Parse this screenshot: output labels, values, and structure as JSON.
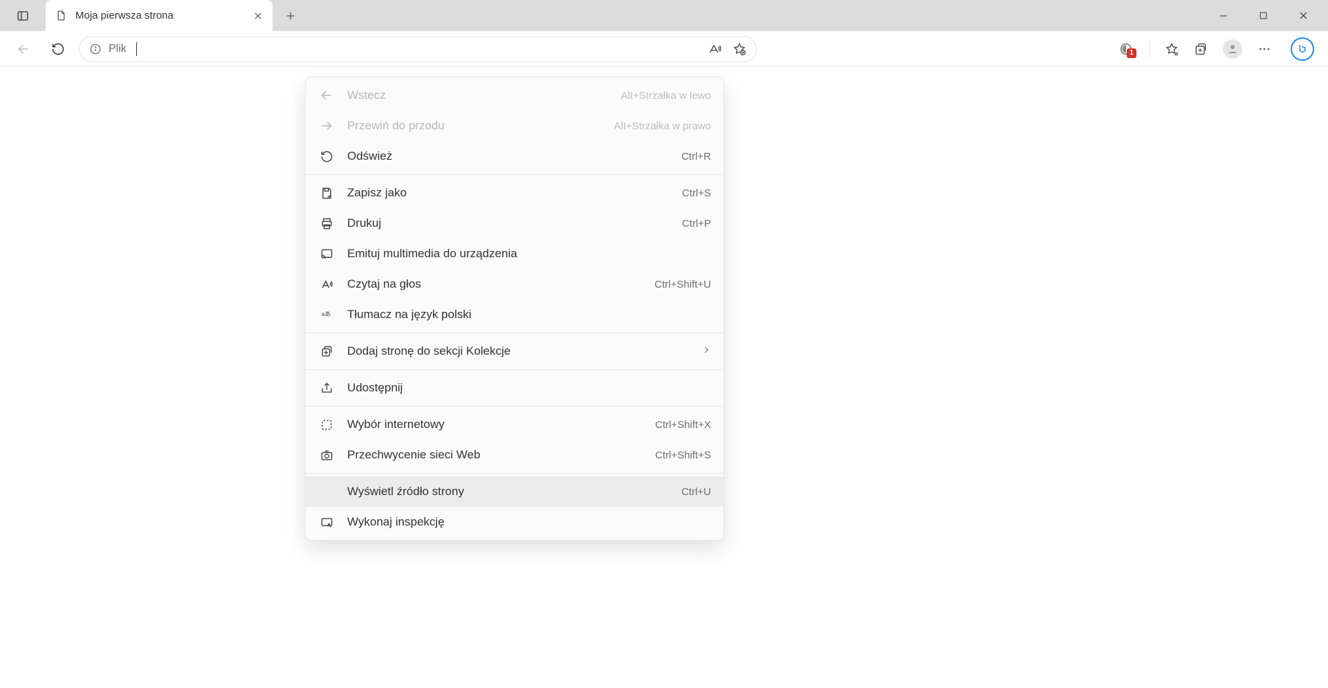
{
  "tab": {
    "title": "Moja pierwsza strona"
  },
  "addr": {
    "text": "Plik"
  },
  "badge": {
    "count": "1"
  },
  "ctx": {
    "back": {
      "label": "Wstecz",
      "accel": "Alt+Strzałka w lewo"
    },
    "forward": {
      "label": "Przewiń do przodu",
      "accel": "Alt+Strzałka w prawo"
    },
    "refresh": {
      "label": "Odśwież",
      "accel": "Ctrl+R"
    },
    "saveas": {
      "label": "Zapisz jako",
      "accel": "Ctrl+S"
    },
    "print": {
      "label": "Drukuj",
      "accel": "Ctrl+P"
    },
    "cast": {
      "label": "Emituj multimedia do urządzenia"
    },
    "readaloud": {
      "label": "Czytaj na głos",
      "accel": "Ctrl+Shift+U"
    },
    "translate": {
      "label": "Tłumacz na język polski"
    },
    "collections": {
      "label": "Dodaj stronę do sekcji Kolekcje"
    },
    "share": {
      "label": "Udostępnij"
    },
    "webselect": {
      "label": "Wybór internetowy",
      "accel": "Ctrl+Shift+X"
    },
    "webcapture": {
      "label": "Przechwycenie sieci Web",
      "accel": "Ctrl+Shift+S"
    },
    "viewsource": {
      "label": "Wyświetl źródło strony",
      "accel": "Ctrl+U"
    },
    "inspect": {
      "label": "Wykonaj inspekcję"
    }
  }
}
